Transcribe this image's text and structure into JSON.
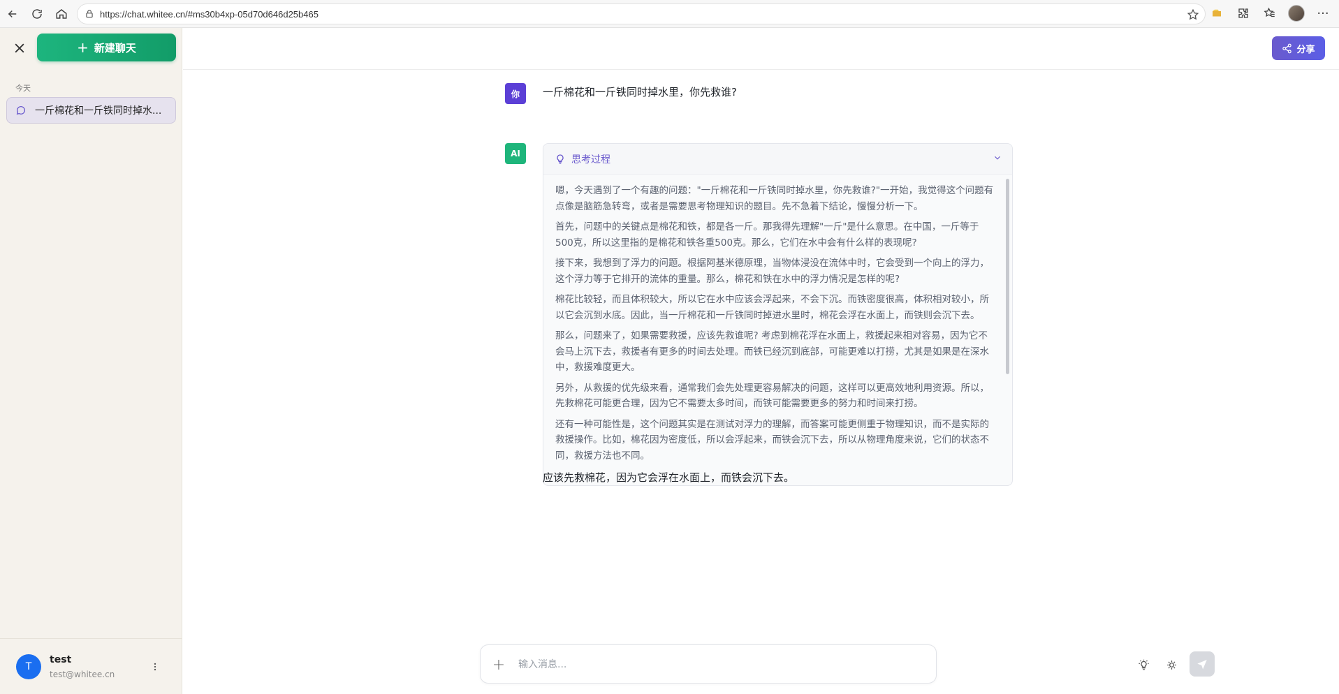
{
  "browser": {
    "url": "https://chat.whitee.cn/#ms30b4xp-05d70d646d25b465"
  },
  "sidebar": {
    "new_chat_label": "新建聊天",
    "section_today": "今天",
    "chat_items": [
      {
        "title": "一斤棉花和一斤铁同时掉水..."
      }
    ],
    "user": {
      "initial": "T",
      "name": "test",
      "email": "test@whitee.cn"
    }
  },
  "header": {
    "share_label": "分享"
  },
  "conversation": {
    "user_avatar": "你",
    "user_message": "一斤棉花和一斤铁同时掉水里，你先救谁?",
    "ai_avatar": "AI",
    "thinking": {
      "label": "思考过程",
      "paragraphs": [
        "嗯，今天遇到了一个有趣的问题：\"一斤棉花和一斤铁同时掉水里，你先救谁?\"一开始，我觉得这个问题有点像是脑筋急转弯，或者是需要思考物理知识的题目。先不急着下结论，慢慢分析一下。",
        "首先，问题中的关键点是棉花和铁，都是各一斤。那我得先理解\"一斤\"是什么意思。在中国，一斤等于500克，所以这里指的是棉花和铁各重500克。那么，它们在水中会有什么样的表现呢?",
        "接下来，我想到了浮力的问题。根据阿基米德原理，当物体浸没在流体中时，它会受到一个向上的浮力，这个浮力等于它排开的流体的重量。那么，棉花和铁在水中的浮力情况是怎样的呢?",
        "棉花比较轻，而且体积较大，所以它在水中应该会浮起来，不会下沉。而铁密度很高，体积相对较小，所以它会沉到水底。因此，当一斤棉花和一斤铁同时掉进水里时，棉花会浮在水面上，而铁则会沉下去。",
        "那么，问题来了，如果需要救援，应该先救谁呢? 考虑到棉花浮在水面上，救援起来相对容易，因为它不会马上沉下去，救援者有更多的时间去处理。而铁已经沉到底部，可能更难以打捞，尤其是如果是在深水中，救援难度更大。",
        "另外，从救援的优先级来看，通常我们会先处理更容易解决的问题，这样可以更高效地利用资源。所以，先救棉花可能更合理，因为它不需要太多时间，而铁可能需要更多的努力和时间来打捞。",
        "还有一种可能性是，这个问题其实是在测试对浮力的理解，而答案可能更侧重于物理知识，而不是实际的救援操作。比如，棉花因为密度低，所以会浮起来，而铁会沉下去，所以从物理角度来说，它们的状态不同，救援方法也不同。"
      ]
    },
    "answer": "应该先救棉花，因为它会浮在水面上，而铁会沉下去。"
  },
  "composer": {
    "placeholder": "输入消息..."
  },
  "colors": {
    "accent_green": "#1db57e",
    "accent_purple": "#6a5acd",
    "user_avatar_bg": "#5b3fd6",
    "profile_blue": "#1a6ef0"
  }
}
